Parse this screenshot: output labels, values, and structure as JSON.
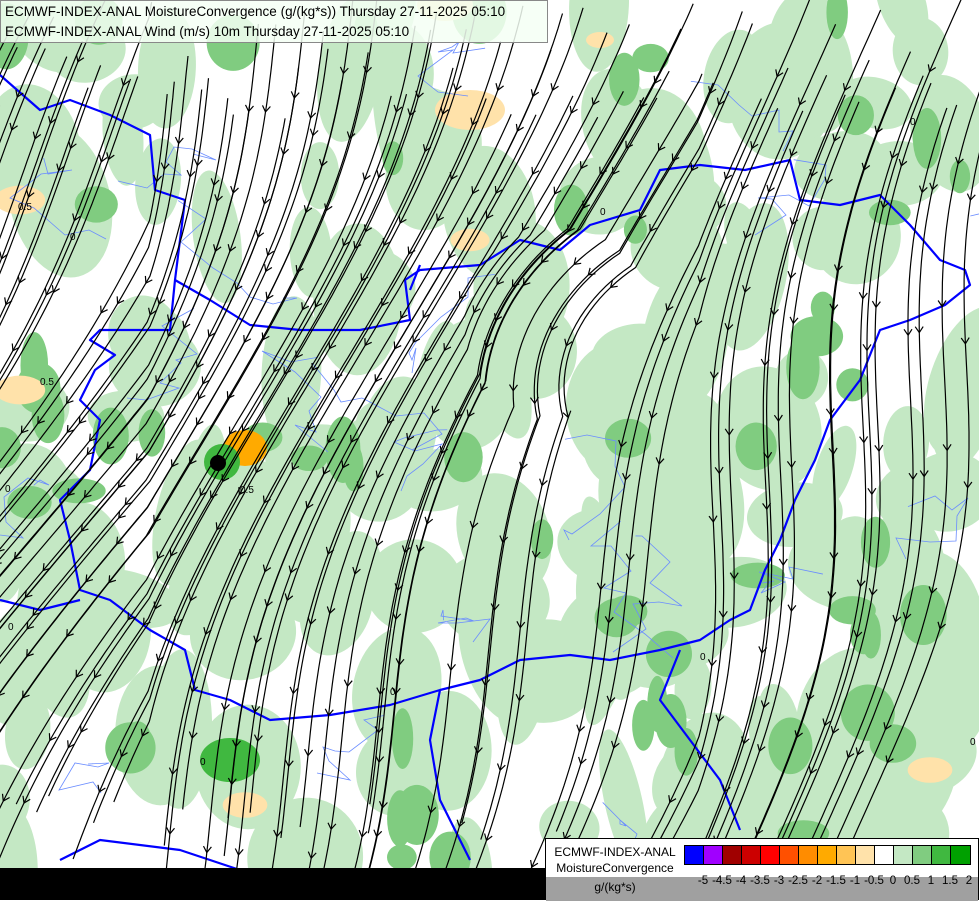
{
  "header": {
    "line1": "ECMWF-INDEX-ANAL MoistureConvergence (g/(kg*s)) Thursday 27-11-2025 05:10",
    "line2": "ECMWF-INDEX-ANAL Wind (m/s) 10m Thursday 27-11-2025 05:10"
  },
  "legend": {
    "title_line1": "ECMWF-INDEX-ANAL",
    "title_line2": "MoistureConvergence",
    "units": "g/(kg*s)",
    "ticks": [
      "-5",
      "-4.5",
      "-4",
      "-3.5",
      "-3",
      "-2.5",
      "-2",
      "-1.5",
      "-1",
      "-0.5",
      "0",
      "0.5",
      "1",
      "1.5",
      "2"
    ],
    "colors": [
      "#0000ff",
      "#a000ff",
      "#a00000",
      "#cc0000",
      "#ff0000",
      "#ff5000",
      "#ff8c00",
      "#ffaa00",
      "#ffc455",
      "#ffe2aa",
      "#ffffff",
      "#c4e8c4",
      "#80cc80",
      "#40b840",
      "#00a000"
    ]
  },
  "map": {
    "contour_labels": [
      "0",
      "0.5",
      "-0.5"
    ],
    "colors": {
      "border": "#0000ff",
      "river": "#6a8cff",
      "streamline": "#000000",
      "convergence_weak": "#c4e8c4",
      "convergence_mid": "#80cc80",
      "convergence_strong": "#40b840",
      "divergence_weak": "#ffe2aa",
      "divergence_mid": "#ffaa00"
    }
  }
}
